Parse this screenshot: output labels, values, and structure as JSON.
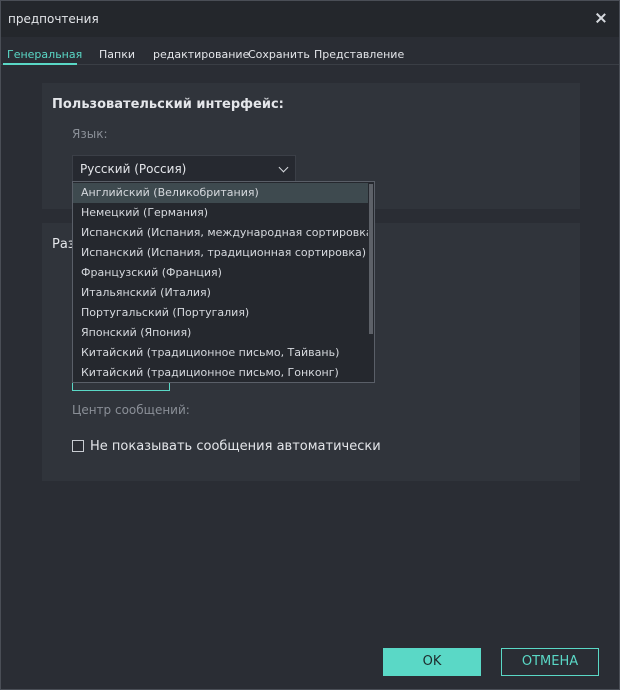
{
  "window": {
    "title": "предпочтения"
  },
  "tabs": [
    {
      "label": "Генеральная"
    },
    {
      "label": "Папки"
    },
    {
      "label": "редактирование"
    },
    {
      "label": "Сохранить"
    },
    {
      "label": "Представление"
    }
  ],
  "ui_section": {
    "title": "Пользовательский интерфейс:",
    "language_label": "Язык:",
    "language_value": "Русский (Россия)"
  },
  "section2": {
    "title_partial": "Раз",
    "message_center_label": "Центр сообщений:",
    "checkbox_label": "Не показывать сообщения автоматически",
    "checkbox_checked": false
  },
  "language_dropdown": {
    "options": [
      "Английский (Великобритания)",
      "Немецкий (Германия)",
      "Испанский (Испания, международная сортировка)",
      "Испанский (Испания, традиционная сортировка)",
      "Французский (Франция)",
      "Итальянский (Италия)",
      "Португальский (Португалия)",
      "Японский (Япония)",
      "Китайский (традиционное письмо, Тайвань)",
      "Китайский (традиционное письмо, Гонконг)"
    ],
    "highlighted_index": 0
  },
  "buttons": {
    "ok": "OK",
    "cancel": "ОТМЕНА"
  },
  "colors": {
    "accent": "#5ad8c6",
    "background": "#2a2d34",
    "panel": "#30343b"
  }
}
